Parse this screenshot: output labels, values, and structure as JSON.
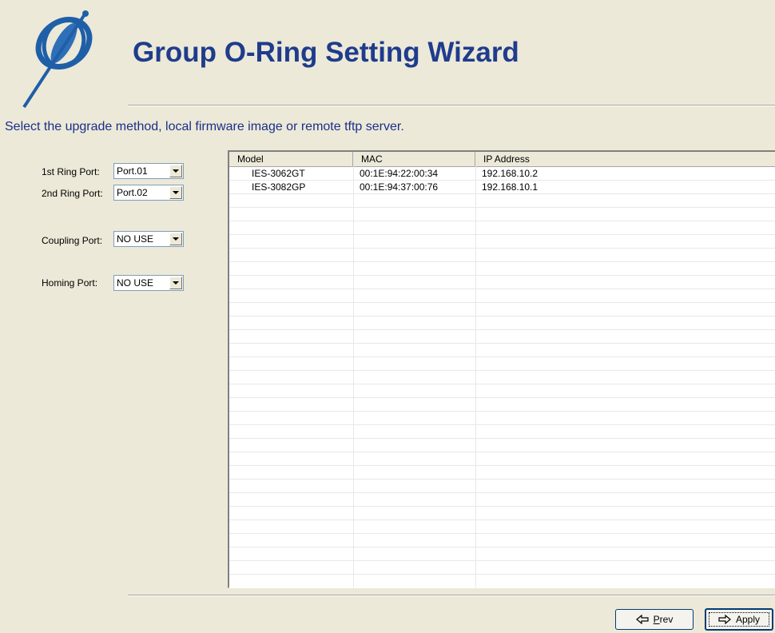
{
  "wizard": {
    "title": "Group O-Ring Setting Wizard",
    "instruction": "Select the upgrade method, local firmware image or remote tftp server.",
    "logo": "ring-logo-icon"
  },
  "form": {
    "ring1": {
      "label": "1st Ring Port:",
      "value": "Port.01"
    },
    "ring2": {
      "label": "2nd Ring Port:",
      "value": "Port.02"
    },
    "coupling": {
      "label": "Coupling Port:",
      "value": "NO USE"
    },
    "homing": {
      "label": "Homing Port:",
      "value": "NO USE"
    }
  },
  "table": {
    "columns": [
      "Model",
      "MAC",
      "IP Address"
    ],
    "rows": [
      [
        "IES-3062GT",
        "00:1E:94:22:00:34",
        "192.168.10.2"
      ],
      [
        "IES-3082GP",
        "00:1E:94:37:00:76",
        "192.168.10.1"
      ]
    ]
  },
  "buttons": {
    "prev_first": "P",
    "prev_rest": "rev",
    "apply_first": "Apply",
    "apply_rest": ""
  },
  "colors": {
    "background": "#ECE9D8",
    "title": "#1F3C8C",
    "instruction": "#1A2F8A"
  }
}
